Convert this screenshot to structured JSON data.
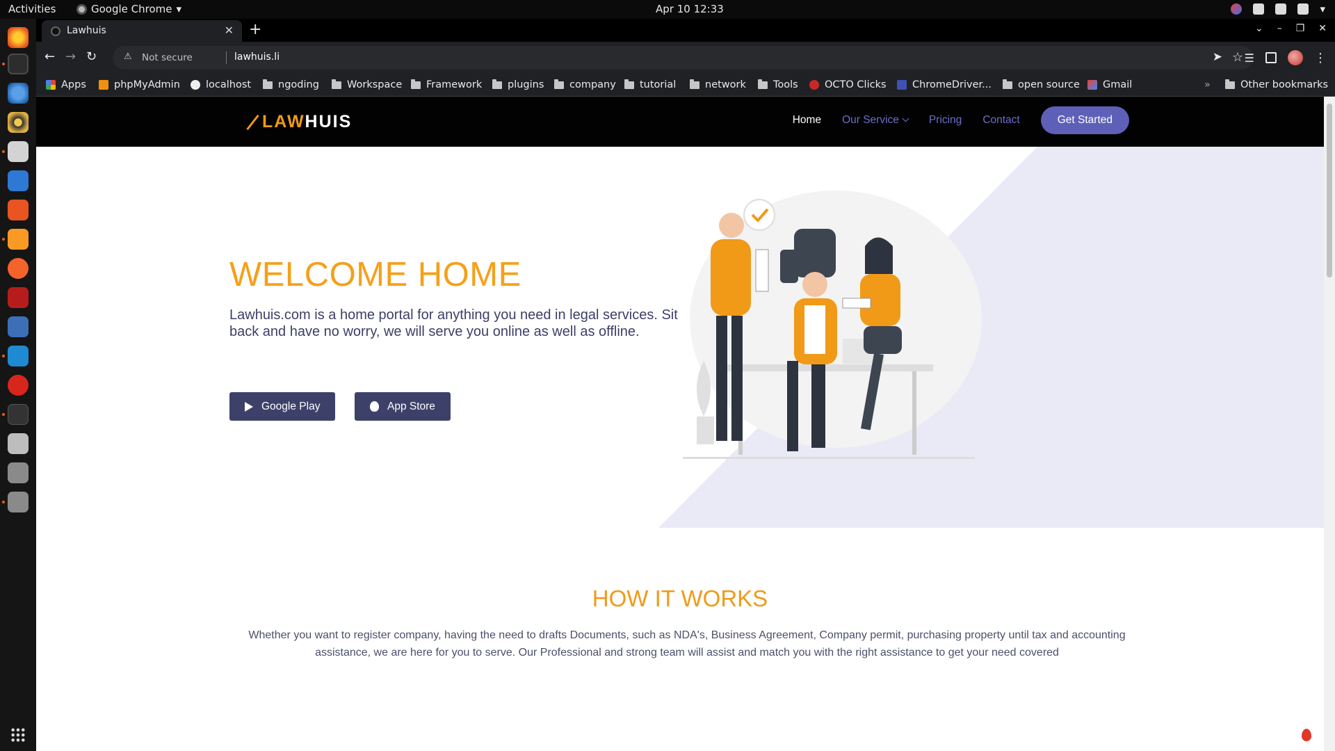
{
  "system": {
    "activities": "Activities",
    "app_name": "Google Chrome",
    "clock": "Apr 10  12:33"
  },
  "browser": {
    "tab_title": "Lawhuis",
    "security": "Not secure",
    "url": "lawhuis.li",
    "bookmarks": [
      "Apps",
      "phpMyAdmin",
      "localhost",
      "ngoding",
      "Workspace",
      "Framework",
      "plugins",
      "company",
      "tutorial",
      "network",
      "Tools",
      "OCTO Clicks",
      "ChromeDriver...",
      "open source",
      "Gmail"
    ],
    "other_bookmarks": "Other bookmarks"
  },
  "site": {
    "logo_left": "LAW",
    "logo_right": "HUIS",
    "nav": {
      "home": "Home",
      "our_service": "Our Service",
      "pricing": "Pricing",
      "contact": "Contact",
      "cta": "Get Started"
    },
    "hero": {
      "title": "WELCOME HOME",
      "text": "Lawhuis.com is a home portal for anything you need in legal services. Sit back and have no worry, we will serve you online as well as offline.",
      "google_play": "Google Play",
      "app_store": "App Store"
    },
    "how": {
      "title": "HOW IT WORKS",
      "text": "Whether you want to register company, having the need to drafts Documents, such as NDA's, Business Agreement, Company permit, purchasing property until tax and accounting assistance, we are here for you to serve. Our Professional and strong team will assist and match you with the right assistance to get your need covered"
    }
  },
  "colors": {
    "accent": "#f09a18",
    "nav_link": "#6b6fc9",
    "cta": "#5e60b8",
    "button": "#3d416a",
    "hero_shape": "#e9eaf5"
  }
}
